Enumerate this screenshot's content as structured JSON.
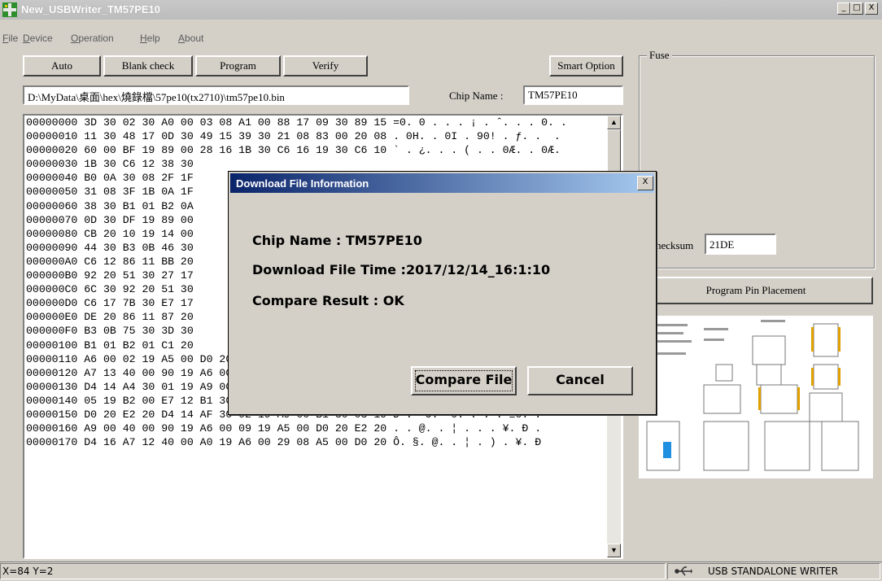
{
  "window": {
    "title": "New_USBWriter_TM57PE10",
    "minimize": "_",
    "maximize": "□",
    "close": "X"
  },
  "menu": {
    "items": [
      {
        "label": "File"
      },
      {
        "label": "Device"
      },
      {
        "label": "Operation"
      },
      {
        "label": "Help"
      },
      {
        "label": "About"
      }
    ]
  },
  "toolbar": {
    "auto": "Auto",
    "blank_check": "Blank check",
    "program": "Program",
    "verify": "Verify",
    "smart_option": "Smart Option"
  },
  "file_path": "D:\\MyData\\桌面\\hex\\燒錄檔\\57pe10(tx2710)\\tm57pe10.bin",
  "chip": {
    "label": "Chip Name :",
    "value": "TM57PE10"
  },
  "hex_rows": [
    "00000000 3D 30 02 30 A0 00 03 08 A1 00 88 17 09 30 89 15 =0. 0 . . . ¡ . ˆ. . . 0. .",
    "00000010 11 30 48 17 0D 30 49 15 39 30 21 08 83 00 20 08 . 0H. . 0I . 90! . ƒ. .  .",
    "00000020 60 00 BF 19 89 00 28 16 1B 30 C6 16 19 30 C6 10 ` . ¿. . . ( . . 0Æ. . 0Æ.",
    "00000030 1B 30 C6 12 38 30",
    "00000040 B0 0A 30 08 2F 1F",
    "00000050 31 08 3F 1B 0A 1F",
    "00000060 38 30 B1 01 B2 0A",
    "00000070 0D 30 DF 19 89 00",
    "00000080 CB 20 10 19 14 00",
    "00000090 44 30 B3 0B 46 30",
    "000000A0 C6 12 86 11 BB 20",
    "000000B0 92 20 51 30 27 17",
    "000000C0 6C 30 92 20 51 30",
    "000000D0 C6 17 7B 30 E7 17",
    "000000E0 DE 20 86 11 87 20",
    "000000F0 B3 0B 75 30 3D 30",
    "00000100 B1 01 B2 01 C1 20",
    "00000110 A6 00 02 19 A5 00 D0 20 E2 20 40 00 A7 11 D4 16 ¦ . . . ¥. Ð .  @§. Ô.",
    "00000120 A7 13 40 00 90 19 A6 00 08 19 A5 00 D0 20 E2 20 §. @. . ¦ . . . ¥. Ð .",
    "00000130 D4 14 A4 30 01 19 A9 00 E7 14 B1 30 B0 01 B1 01 Ô. ¤0. . . . ç. ±0°. ±.",
    "00000140 05 19 B2 00 E7 12 B1 30 90 19 A6 00 07 19 A5 00 . . ². ç. ±0. ¦ . . . ¥.",
    "00000150 D0 20 E2 20 D4 14 AF 30 02 19 A9 00 B1 30 03 19 Ð .  Ô. ¯0. . . . ±0. .",
    "00000160 A9 00 40 00 90 19 A6 00 09 19 A5 00 D0 20 E2 20 . . @. . ¦ . . . ¥. Ð .",
    "00000170 D4 16 A7 12 40 00 A0 19 A6 00 29 08 A5 00 D0 20 Ô. §. @. . ¦ . ) . ¥. Ð"
  ],
  "fuse": {
    "title": "Fuse",
    "checksum_label": "hecksum",
    "checksum_value": "21DE"
  },
  "program_pin_button": "Program Pin Placement",
  "dialog": {
    "title": "Download File Information",
    "close": "X",
    "chip_line": "Chip Name : TM57PE10",
    "time_line": "Download File Time :2017/12/14_16:1:10",
    "result_line": "Compare Result : OK",
    "compare_button": "Compare File",
    "cancel_button": "Cancel"
  },
  "status": {
    "coords": "X=84 Y=2",
    "device": "USB STANDALONE WRITER"
  }
}
